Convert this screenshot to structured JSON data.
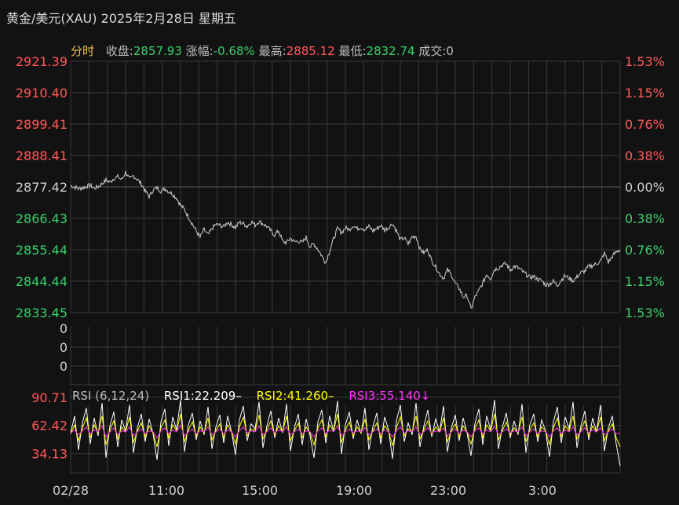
{
  "header": {
    "title": "黄金/美元(XAU) 2025年2月28日 星期五"
  },
  "infobar": {
    "mode": "分时",
    "close_label": "收盘:",
    "close_value": "2857.93",
    "change_label": "涨幅:",
    "change_value": "-0.68%",
    "high_label": "最高:",
    "high_value": "2885.12",
    "low_label": "最低:",
    "low_value": "2832.74",
    "volume_label": "成交:",
    "volume_value": "0"
  },
  "rsi_legend": {
    "title": "RSI (6,12,24)",
    "rsi1": "RSI1:22.209–",
    "rsi2": "RSI2:41.260–",
    "rsi3": "RSI3:55.140↓"
  },
  "colors": {
    "up": "#ff5a5a",
    "down": "#3ad06b",
    "price_line": "#cfcfcf",
    "rsi1": "#ffffff",
    "rsi2": "#ffff00",
    "rsi3": "#ff33ff",
    "grid": "#3a3a3a",
    "axis_text": "#d0d0d0"
  },
  "chart_data": [
    {
      "type": "line",
      "name": "price",
      "x_ticks": [
        "02/28",
        "11:00",
        "15:00",
        "19:00",
        "23:00",
        "3:00"
      ],
      "y_ticks_left": [
        "2921.39",
        "2910.40",
        "2899.41",
        "2888.41",
        "2877.42",
        "2866.43",
        "2855.44",
        "2844.44",
        "2833.45"
      ],
      "y_ticks_right": [
        "1.53%",
        "1.15%",
        "0.76%",
        "0.38%",
        "0.00%",
        "0.38%",
        "0.76%",
        "1.15%",
        "1.53%"
      ],
      "ylim": [
        2833.45,
        2921.39
      ],
      "reference": 2877.42,
      "x": [
        0,
        5,
        10,
        15,
        20,
        25,
        30,
        35,
        40,
        45,
        50,
        55,
        60,
        65,
        70,
        75,
        80,
        85,
        90,
        95,
        100,
        105,
        110,
        115,
        120,
        125,
        130,
        135,
        140,
        145,
        150,
        155,
        160,
        165,
        170,
        175,
        180,
        185,
        190,
        195,
        200,
        205,
        210,
        215,
        220,
        225,
        230,
        235,
        240,
        245,
        250,
        255,
        260,
        265,
        270,
        275,
        280,
        285,
        290,
        295,
        300,
        305,
        310,
        315,
        320,
        325,
        330,
        335,
        340,
        345,
        350,
        355,
        360,
        365,
        370,
        375,
        380,
        385,
        390,
        395,
        400,
        405,
        410,
        415,
        420,
        425,
        430,
        435,
        440,
        445,
        450,
        455,
        460,
        465,
        470,
        475,
        480,
        485,
        490,
        495,
        500,
        505,
        510,
        515,
        520,
        525,
        530,
        535,
        540,
        545,
        550,
        555,
        560,
        565,
        570,
        575,
        580,
        585,
        590,
        595,
        600,
        605,
        610,
        615,
        620,
        625,
        630,
        635,
        640,
        645,
        650,
        655,
        660,
        665,
        670,
        675,
        680,
        685,
        690,
        695,
        700
      ],
      "values": [
        2877.9,
        2877.4,
        2876.8,
        2877.1,
        2877.6,
        2878.0,
        2876.9,
        2877.5,
        2878.6,
        2879.8,
        2879.1,
        2880.4,
        2881.0,
        2879.9,
        2882.6,
        2880.1,
        2881.3,
        2880.0,
        2878.5,
        2876.0,
        2874.0,
        2876.3,
        2877.1,
        2876.0,
        2876.9,
        2875.8,
        2874.9,
        2873.5,
        2871.0,
        2869.5,
        2867.0,
        2864.5,
        2862.0,
        2859.8,
        2862.5,
        2860.5,
        2862.8,
        2864.3,
        2864.0,
        2863.5,
        2865.1,
        2864.2,
        2863.2,
        2865.0,
        2864.6,
        2863.6,
        2865.3,
        2864.1,
        2865.4,
        2864.5,
        2863.6,
        2862.0,
        2860.6,
        2862.1,
        2858.4,
        2857.9,
        2859.5,
        2858.2,
        2858.5,
        2857.9,
        2859.8,
        2856.4,
        2857.5,
        2855.6,
        2853.3,
        2851.0,
        2855.1,
        2859.2,
        2862.9,
        2861.4,
        2863.1,
        2862.5,
        2864.0,
        2862.8,
        2863.3,
        2862.5,
        2863.6,
        2862.1,
        2862.8,
        2863.9,
        2862.4,
        2863.2,
        2864.6,
        2862.1,
        2858.9,
        2859.6,
        2857.4,
        2859.9,
        2860.2,
        2855.6,
        2854.3,
        2855.5,
        2851.5,
        2849.5,
        2847.0,
        2845.5,
        2848.4,
        2846.8,
        2843.5,
        2842.0,
        2838.9,
        2839.4,
        2834.7,
        2838.8,
        2841.1,
        2843.8,
        2846.8,
        2845.4,
        2848.6,
        2849.0,
        2850.2,
        2850.5,
        2848.3,
        2849.6,
        2849.1,
        2848.0,
        2846.9,
        2845.7,
        2846.1,
        2845.1,
        2844.6,
        2843.2,
        2843.4,
        2844.4,
        2843.0,
        2844.9,
        2846.3,
        2845.5,
        2844.6,
        2845.9,
        2847.4,
        2848.0,
        2849.6,
        2849.9,
        2850.6,
        2851.4,
        2854.2,
        2851.1,
        2853.1,
        2854.7,
        2855.4
      ]
    },
    {
      "type": "bar",
      "name": "volume",
      "y_ticks": [
        "0",
        "0",
        "0"
      ],
      "values": [
        0
      ]
    },
    {
      "type": "line",
      "name": "RSI (6,12,24)",
      "y_ticks": [
        "90.71",
        "62.42",
        "34.13"
      ],
      "ylim": [
        15,
        100
      ],
      "series": [
        {
          "name": "RSI1",
          "color": "#ffffff",
          "values": [
            55,
            72,
            38,
            65,
            80,
            44,
            70,
            52,
            85,
            30,
            62,
            76,
            41,
            68,
            57,
            83,
            35,
            60,
            74,
            46,
            69,
            54,
            28,
            66,
            79,
            42,
            71,
            58,
            88,
            36,
            63,
            75,
            48,
            67,
            53,
            81,
            39,
            61,
            73,
            45,
            72,
            56,
            33,
            68,
            82,
            47,
            64,
            59,
            86,
            40,
            62,
            77,
            50,
            70,
            55,
            84,
            37,
            60,
            74,
            43,
            69,
            52,
            30,
            66,
            78,
            45,
            72,
            57,
            87,
            34,
            63,
            76,
            49,
            68,
            54,
            80,
            38,
            61,
            75,
            44,
            71,
            58,
            29,
            67,
            83,
            46,
            65,
            53,
            85,
            41,
            62,
            78,
            51,
            69,
            56,
            82,
            36,
            60,
            73,
            47,
            70,
            55,
            32,
            64,
            79,
            43,
            72,
            58,
            88,
            39,
            61,
            75,
            50,
            67,
            53,
            84,
            35,
            63,
            74,
            46,
            68,
            57,
            31,
            66,
            81,
            45,
            71,
            59,
            86,
            40,
            62,
            77,
            48,
            70,
            56,
            83,
            37,
            60,
            72,
            44,
            22
          ]
        },
        {
          "name": "RSI2",
          "color": "#ffff00",
          "values": [
            54,
            63,
            47,
            60,
            70,
            50,
            63,
            55,
            72,
            43,
            58,
            67,
            49,
            61,
            56,
            71,
            45,
            57,
            65,
            51,
            62,
            55,
            41,
            60,
            68,
            50,
            63,
            57,
            74,
            46,
            58,
            66,
            52,
            61,
            55,
            70,
            48,
            57,
            64,
            50,
            63,
            56,
            44,
            61,
            71,
            52,
            59,
            57,
            73,
            49,
            58,
            67,
            53,
            62,
            56,
            72,
            47,
            57,
            65,
            50,
            61,
            55,
            43,
            60,
            68,
            51,
            63,
            57,
            74,
            45,
            58,
            66,
            52,
            61,
            55,
            69,
            48,
            57,
            65,
            50,
            62,
            57,
            42,
            60,
            71,
            52,
            59,
            56,
            72,
            49,
            58,
            67,
            53,
            61,
            56,
            70,
            46,
            57,
            64,
            51,
            62,
            56,
            44,
            59,
            68,
            50,
            63,
            57,
            74,
            48,
            57,
            66,
            53,
            60,
            55,
            71,
            46,
            58,
            65,
            51,
            61,
            57,
            43,
            60,
            70,
            51,
            62,
            57,
            72,
            49,
            58,
            67,
            52,
            62,
            56,
            71,
            47,
            57,
            64,
            50,
            41
          ]
        },
        {
          "name": "RSI3",
          "color": "#ff33ff",
          "values": [
            55,
            58,
            53,
            57,
            61,
            54,
            58,
            56,
            62,
            51,
            56,
            60,
            53,
            57,
            56,
            61,
            52,
            56,
            59,
            54,
            57,
            56,
            50,
            57,
            60,
            54,
            58,
            56,
            63,
            52,
            56,
            59,
            54,
            57,
            56,
            61,
            53,
            56,
            59,
            54,
            58,
            56,
            51,
            57,
            61,
            55,
            57,
            56,
            62,
            53,
            56,
            60,
            55,
            58,
            56,
            61,
            53,
            56,
            59,
            54,
            57,
            56,
            51,
            57,
            60,
            54,
            58,
            56,
            62,
            52,
            56,
            59,
            55,
            57,
            56,
            60,
            53,
            56,
            59,
            54,
            58,
            56,
            51,
            57,
            61,
            55,
            57,
            56,
            61,
            53,
            56,
            60,
            55,
            57,
            56,
            60,
            52,
            56,
            59,
            54,
            58,
            56,
            51,
            57,
            60,
            54,
            58,
            56,
            62,
            53,
            56,
            59,
            55,
            57,
            56,
            61,
            52,
            56,
            59,
            54,
            57,
            56,
            51,
            57,
            60,
            54,
            58,
            56,
            61,
            53,
            56,
            60,
            55,
            58,
            56,
            60,
            53,
            56,
            59,
            54,
            55
          ]
        }
      ]
    }
  ]
}
